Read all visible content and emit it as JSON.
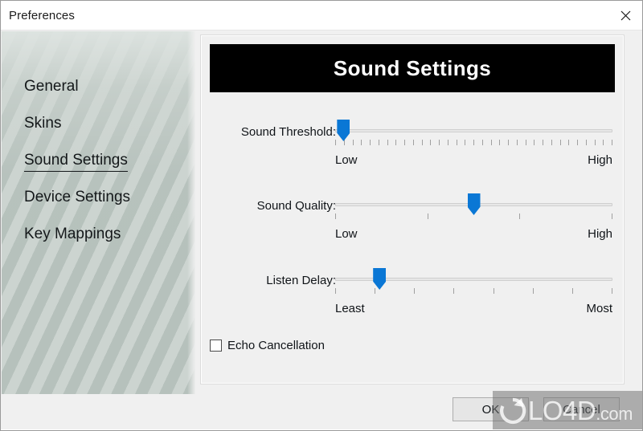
{
  "window": {
    "title": "Preferences",
    "close_icon": "close-icon"
  },
  "sidebar": {
    "items": [
      {
        "label": "General",
        "selected": false
      },
      {
        "label": "Skins",
        "selected": false
      },
      {
        "label": "Sound Settings",
        "selected": true
      },
      {
        "label": "Device Settings",
        "selected": false
      },
      {
        "label": "Key Mappings",
        "selected": false
      }
    ]
  },
  "content": {
    "banner_title": "Sound Settings",
    "sliders": [
      {
        "label": "Sound Threshold:",
        "value_pct": 3,
        "tick_count": 33,
        "min_label": "Low",
        "max_label": "High"
      },
      {
        "label": "Sound Quality:",
        "value_pct": 50,
        "tick_count": 4,
        "min_label": "Low",
        "max_label": "High"
      },
      {
        "label": "Listen Delay:",
        "value_pct": 16,
        "tick_count": 8,
        "min_label": "Least",
        "max_label": "Most"
      }
    ],
    "checkbox": {
      "label": "Echo Cancellation",
      "checked": false
    }
  },
  "footer": {
    "ok_label": "OK",
    "cancel_label": "Cancel"
  },
  "watermark": {
    "text": "LO4D",
    "suffix": ".com"
  },
  "colors": {
    "accent": "#0a77d5",
    "banner_bg": "#000000",
    "panel_bg": "#f0f0f0",
    "sidebar_stripe_dark": "#b6c1bc",
    "sidebar_stripe_light": "#ccd4d0"
  }
}
